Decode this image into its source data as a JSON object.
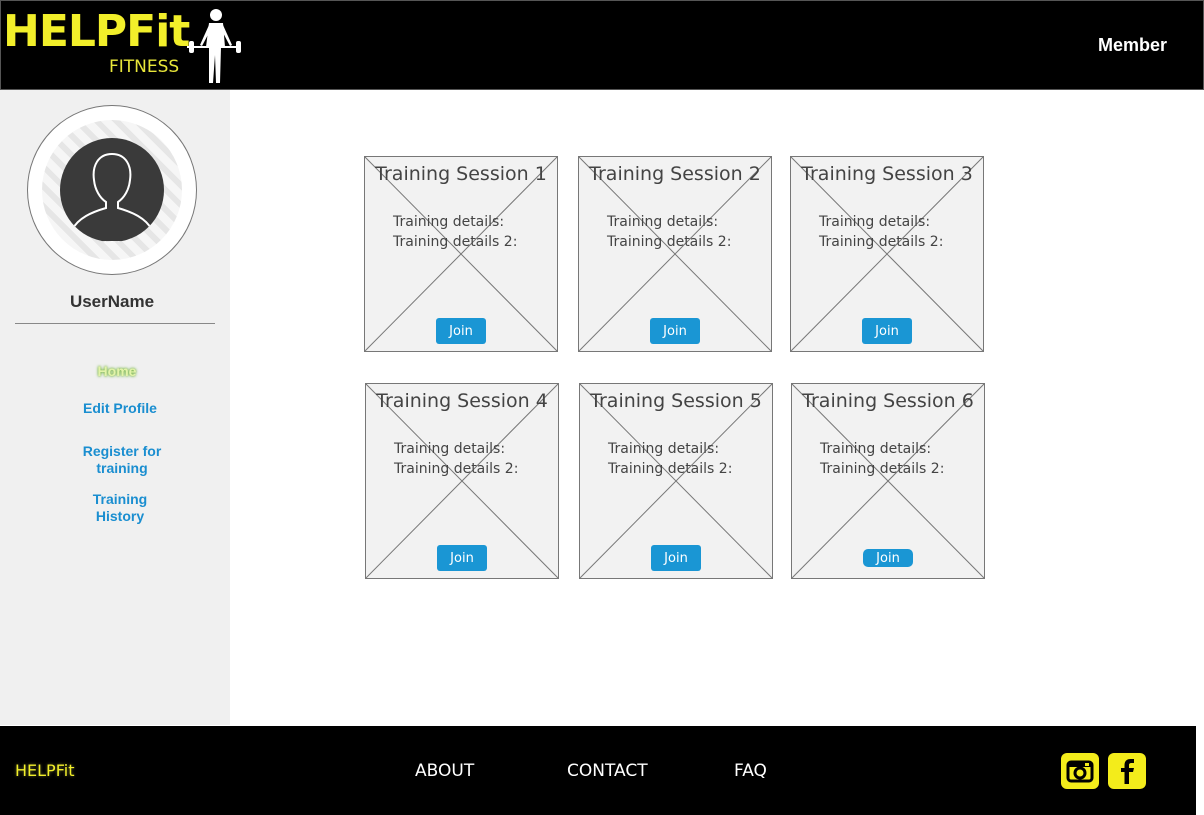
{
  "header": {
    "logo_main": "HELPFit",
    "logo_sub": "FITNESS",
    "role_label": "Member"
  },
  "sidebar": {
    "username": "UserName",
    "nav": {
      "home": "Home",
      "edit_profile": "Edit Profile",
      "register_line1": "Register for",
      "register_line2": "training",
      "history_line1": "Training",
      "history_line2": "History"
    }
  },
  "sessions": [
    {
      "title": "Training Session 1",
      "detail1": "Training details:",
      "detail2": "Training details 2:",
      "button": "Join"
    },
    {
      "title": "Training Session 2",
      "detail1": "Training details:",
      "detail2": "Training details 2:",
      "button": "Join"
    },
    {
      "title": "Training Session 3",
      "detail1": "Training details:",
      "detail2": "Training details 2:",
      "button": "Join"
    },
    {
      "title": "Training Session 4",
      "detail1": "Training details:",
      "detail2": "Training details 2:",
      "button": "Join"
    },
    {
      "title": "Training Session 5",
      "detail1": "Training details:",
      "detail2": "Training details 2:",
      "button": "Join"
    },
    {
      "title": "Training Session 6",
      "detail1": "Training details:",
      "detail2": "Training details 2:",
      "button": "Join"
    }
  ],
  "footer": {
    "brand": "HELPFit",
    "links": {
      "about": "ABOUT",
      "contact": "CONTACT",
      "faq": "FAQ"
    },
    "social": {
      "instagram": "instagram-icon",
      "facebook": "facebook-icon"
    }
  },
  "colors": {
    "brand_yellow": "#f2ef2a",
    "link_blue": "#1a8ed0",
    "button_blue": "#1a96d4",
    "header_bg": "#000000",
    "sidebar_bg": "#f0f0f0"
  }
}
